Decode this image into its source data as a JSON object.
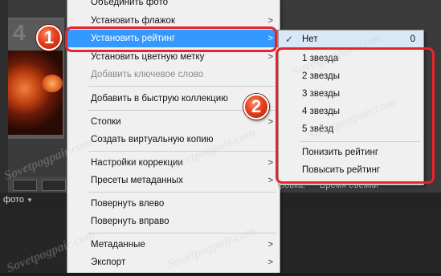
{
  "background": {
    "photo_number": "4",
    "photo_label": "фото",
    "sort_text_1": "ровка:",
    "sort_text_2": "Время съемки"
  },
  "menu": {
    "items": [
      {
        "label": "Объединить фото",
        "disabled": false,
        "has_submenu": false
      },
      {
        "label": "Установить флажок",
        "disabled": false,
        "has_submenu": true
      },
      {
        "label": "Установить рейтинг",
        "disabled": false,
        "has_submenu": true,
        "highlighted": true
      },
      {
        "label": "Установить цветную метку",
        "disabled": false,
        "has_submenu": true
      },
      {
        "label": "Добавить ключевое слово",
        "disabled": true,
        "has_submenu": false
      },
      {
        "label": "Добавить в быструю коллекцию",
        "disabled": false,
        "has_submenu": false
      },
      {
        "label": "Стопки",
        "disabled": false,
        "has_submenu": true
      },
      {
        "label": "Создать виртуальную копию",
        "disabled": false,
        "has_submenu": false
      },
      {
        "label": "Настройки коррекции",
        "disabled": false,
        "has_submenu": true
      },
      {
        "label": "Пресеты метаданных",
        "disabled": false,
        "has_submenu": true
      },
      {
        "label": "Повернуть влево",
        "disabled": false,
        "has_submenu": false
      },
      {
        "label": "Повернуть вправо",
        "disabled": false,
        "has_submenu": false
      },
      {
        "label": "Метаданные",
        "disabled": false,
        "has_submenu": true
      },
      {
        "label": "Экспорт",
        "disabled": false,
        "has_submenu": true
      }
    ],
    "arrow": ">"
  },
  "submenu": {
    "none_label": "Нет",
    "none_shortcut": "0",
    "ratings": [
      "1 звезда",
      "2 звезды",
      "3 звезды",
      "4 звезды",
      "5 звёзд"
    ],
    "decrease_label": "Понизить рейтинг",
    "increase_label": "Повысить рейтинг",
    "check_glyph": "✓"
  },
  "annotations": {
    "step1": "1",
    "step2": "2",
    "watermark": "Sovetpogpair.com"
  },
  "colors": {
    "highlight": "#3399ff",
    "annotation_red": "#e8242b"
  }
}
